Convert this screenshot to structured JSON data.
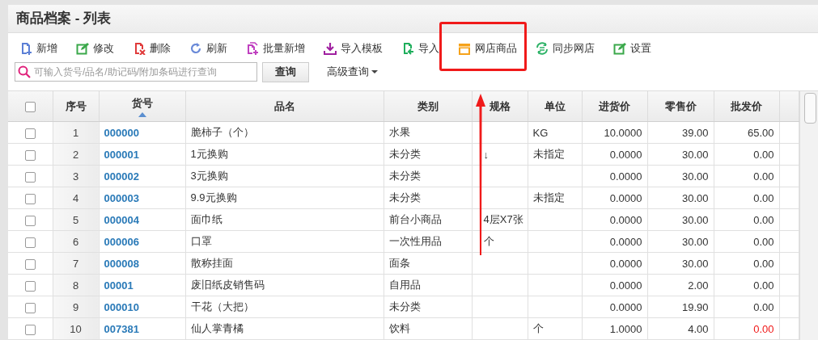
{
  "window": {
    "title": "商品档案 - 列表"
  },
  "toolbar": [
    {
      "kind": "new",
      "label": "新增"
    },
    {
      "kind": "edit",
      "label": "修改"
    },
    {
      "kind": "delete",
      "label": "删除"
    },
    {
      "kind": "refresh",
      "label": "刷新"
    },
    {
      "kind": "batch",
      "label": "批量新增"
    },
    {
      "kind": "template",
      "label": "导入模板"
    },
    {
      "kind": "import",
      "label": "导入"
    },
    {
      "kind": "shop",
      "label": "网店商品"
    },
    {
      "kind": "sync",
      "label": "同步网店"
    },
    {
      "kind": "settings",
      "label": "设置"
    }
  ],
  "search": {
    "placeholder": "可输入货号/品名/助记码/附加条码进行查询",
    "button": "查询",
    "advanced": "高级查询"
  },
  "table": {
    "select_all_checked": false,
    "columns": [
      {
        "label": "序号",
        "sorted": false
      },
      {
        "label": "货号",
        "sorted": true
      },
      {
        "label": "品名",
        "sorted": false
      },
      {
        "label": "类别",
        "sorted": false
      },
      {
        "label": "规格",
        "sorted": false
      },
      {
        "label": "单位",
        "sorted": false
      },
      {
        "label": "进货价",
        "sorted": false
      },
      {
        "label": "零售价",
        "sorted": false
      },
      {
        "label": "批发价",
        "sorted": false
      }
    ],
    "rows": [
      {
        "checked": false,
        "no": "1",
        "code": "000000",
        "name": "脆柿子（个）",
        "category": "水果",
        "spec": "",
        "unit": "KG",
        "cost": "10.0000",
        "retail": "39.00",
        "wholesale": "65.00",
        "wholesale_alert": false
      },
      {
        "checked": false,
        "no": "2",
        "code": "000001",
        "name": "1元换购",
        "category": "未分类",
        "spec": "↓",
        "unit": "未指定",
        "cost": "0.0000",
        "retail": "30.00",
        "wholesale": "0.00",
        "wholesale_alert": false
      },
      {
        "checked": false,
        "no": "3",
        "code": "000002",
        "name": "3元换购",
        "category": "未分类",
        "spec": "",
        "unit": "",
        "cost": "0.0000",
        "retail": "30.00",
        "wholesale": "0.00",
        "wholesale_alert": false
      },
      {
        "checked": false,
        "no": "4",
        "code": "000003",
        "name": "9.9元换购",
        "category": "未分类",
        "spec": "",
        "unit": "未指定",
        "cost": "0.0000",
        "retail": "30.00",
        "wholesale": "0.00",
        "wholesale_alert": false
      },
      {
        "checked": false,
        "no": "5",
        "code": "000004",
        "name": "面巾纸",
        "category": "前台小商品",
        "spec": "4层X7张",
        "unit": "",
        "cost": "0.0000",
        "retail": "30.00",
        "wholesale": "0.00",
        "wholesale_alert": false
      },
      {
        "checked": false,
        "no": "6",
        "code": "000006",
        "name": "口罩",
        "category": "一次性用品",
        "spec": "个",
        "unit": "",
        "cost": "0.0000",
        "retail": "30.00",
        "wholesale": "0.00",
        "wholesale_alert": false
      },
      {
        "checked": false,
        "no": "7",
        "code": "000008",
        "name": "散称挂面",
        "category": "面条",
        "spec": "",
        "unit": "",
        "cost": "0.0000",
        "retail": "30.00",
        "wholesale": "0.00",
        "wholesale_alert": false
      },
      {
        "checked": false,
        "no": "8",
        "code": "00001",
        "name": "废旧纸皮销售码",
        "category": "自用品",
        "spec": "",
        "unit": "",
        "cost": "0.0000",
        "retail": "2.00",
        "wholesale": "0.00",
        "wholesale_alert": false
      },
      {
        "checked": false,
        "no": "9",
        "code": "000010",
        "name": "干花（大把）",
        "category": "未分类",
        "spec": "",
        "unit": "",
        "cost": "0.0000",
        "retail": "19.90",
        "wholesale": "0.00",
        "wholesale_alert": false
      },
      {
        "checked": false,
        "no": "10",
        "code": "007381",
        "name": "仙人掌青橘",
        "category": "饮料",
        "spec": "",
        "unit": "个",
        "cost": "1.0000",
        "retail": "4.00",
        "wholesale": "0.00",
        "wholesale_alert": true
      }
    ]
  }
}
